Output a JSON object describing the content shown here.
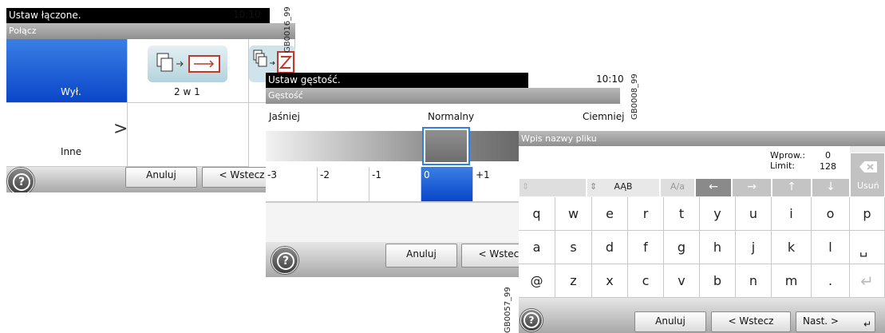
{
  "screen1": {
    "title": "Ustaw łączone.",
    "time": "10:10",
    "code": "GB0016_99",
    "subtitle": "Połącz",
    "options": [
      {
        "label": "Wył.",
        "selected": true
      },
      {
        "label": "2 w 1",
        "selected": false
      },
      {
        "label": "",
        "selected": false
      }
    ],
    "other_label": "Inne",
    "other_chevron": ">",
    "cancel": "Anuluj",
    "back": "< Wstecz",
    "help": "?"
  },
  "screen2": {
    "title": "Ustaw gęstość.",
    "time": "10:10",
    "code": "GB0008_99",
    "subtitle": "Gęstość",
    "lighter": "Jaśniej",
    "normal": "Normalny",
    "darker": "Ciemniej",
    "scale": [
      "-3",
      "-2",
      "-1",
      "0",
      "+1"
    ],
    "selected_value": "0",
    "cancel": "Anuluj",
    "back": "< Wstecz",
    "help": "?"
  },
  "screen3": {
    "subtitle": "Wpis nazwy pliku",
    "code": "GB0057_99",
    "input_label": "Wprow.:",
    "input_count": "0",
    "limit_label": "Limit:",
    "limit_value": "128",
    "delete": "Usuń",
    "shift_label": "AĄB",
    "case_label": "A/a",
    "rows": [
      [
        "q",
        "w",
        "e",
        "r",
        "t",
        "y",
        "u",
        "i",
        "o",
        "p"
      ],
      [
        "a",
        "s",
        "d",
        "f",
        "g",
        "h",
        "j",
        "k",
        "l",
        "␣"
      ],
      [
        "@",
        "z",
        "x",
        "c",
        "v",
        "b",
        "n",
        "m",
        ".",
        "↵"
      ]
    ],
    "cancel": "Anuluj",
    "back": "< Wstecz",
    "next": "Nast. >",
    "help": "?"
  }
}
